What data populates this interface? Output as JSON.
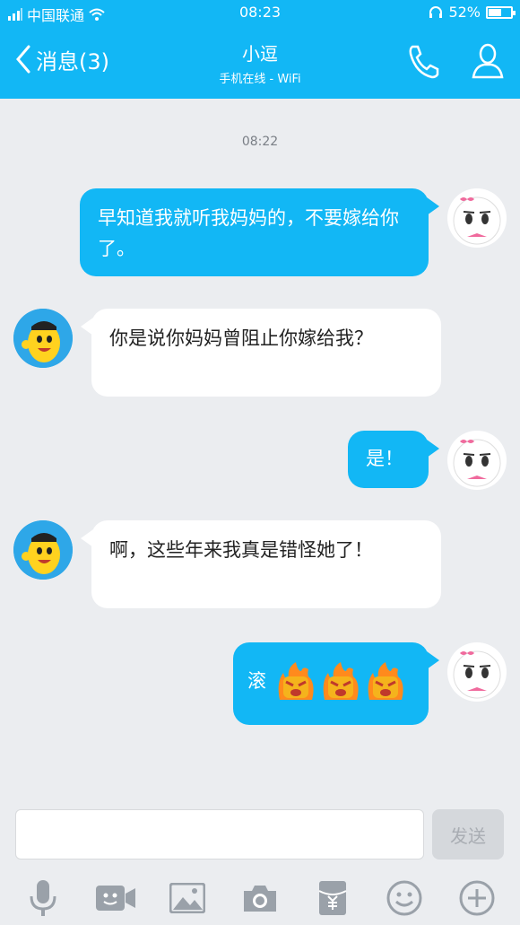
{
  "status_bar": {
    "carrier": "中国联通",
    "time": "08:23",
    "battery": "52%",
    "battery_level": 0.52
  },
  "header": {
    "back_label": "消息(3)",
    "contact_name": "小逗",
    "contact_status": "手机在线 - WiFi",
    "call_icon": "phone-icon",
    "profile_icon": "person-icon"
  },
  "chat": {
    "timestamp": "08:22",
    "messages": [
      {
        "from": "me",
        "text": "早知道我就听我妈妈的，不要嫁给你了。"
      },
      {
        "from": "them",
        "text": "你是说你妈妈曾阻止你嫁给我？"
      },
      {
        "from": "me",
        "text": "是！"
      },
      {
        "from": "them",
        "text": "啊，这些年来我真是错怪她了！"
      },
      {
        "from": "me",
        "text": "滚",
        "emojis": [
          "angry-fire-emoji",
          "angry-fire-emoji",
          "angry-fire-emoji"
        ]
      }
    ]
  },
  "composer": {
    "placeholder": "",
    "send_label": "发送"
  },
  "toolbar": {
    "items": [
      "microphone-icon",
      "video-icon",
      "image-icon",
      "camera-icon",
      "red-packet-icon",
      "emoji-icon",
      "plus-icon"
    ]
  },
  "colors": {
    "accent": "#12b7f5",
    "background": "#ebedf0"
  }
}
